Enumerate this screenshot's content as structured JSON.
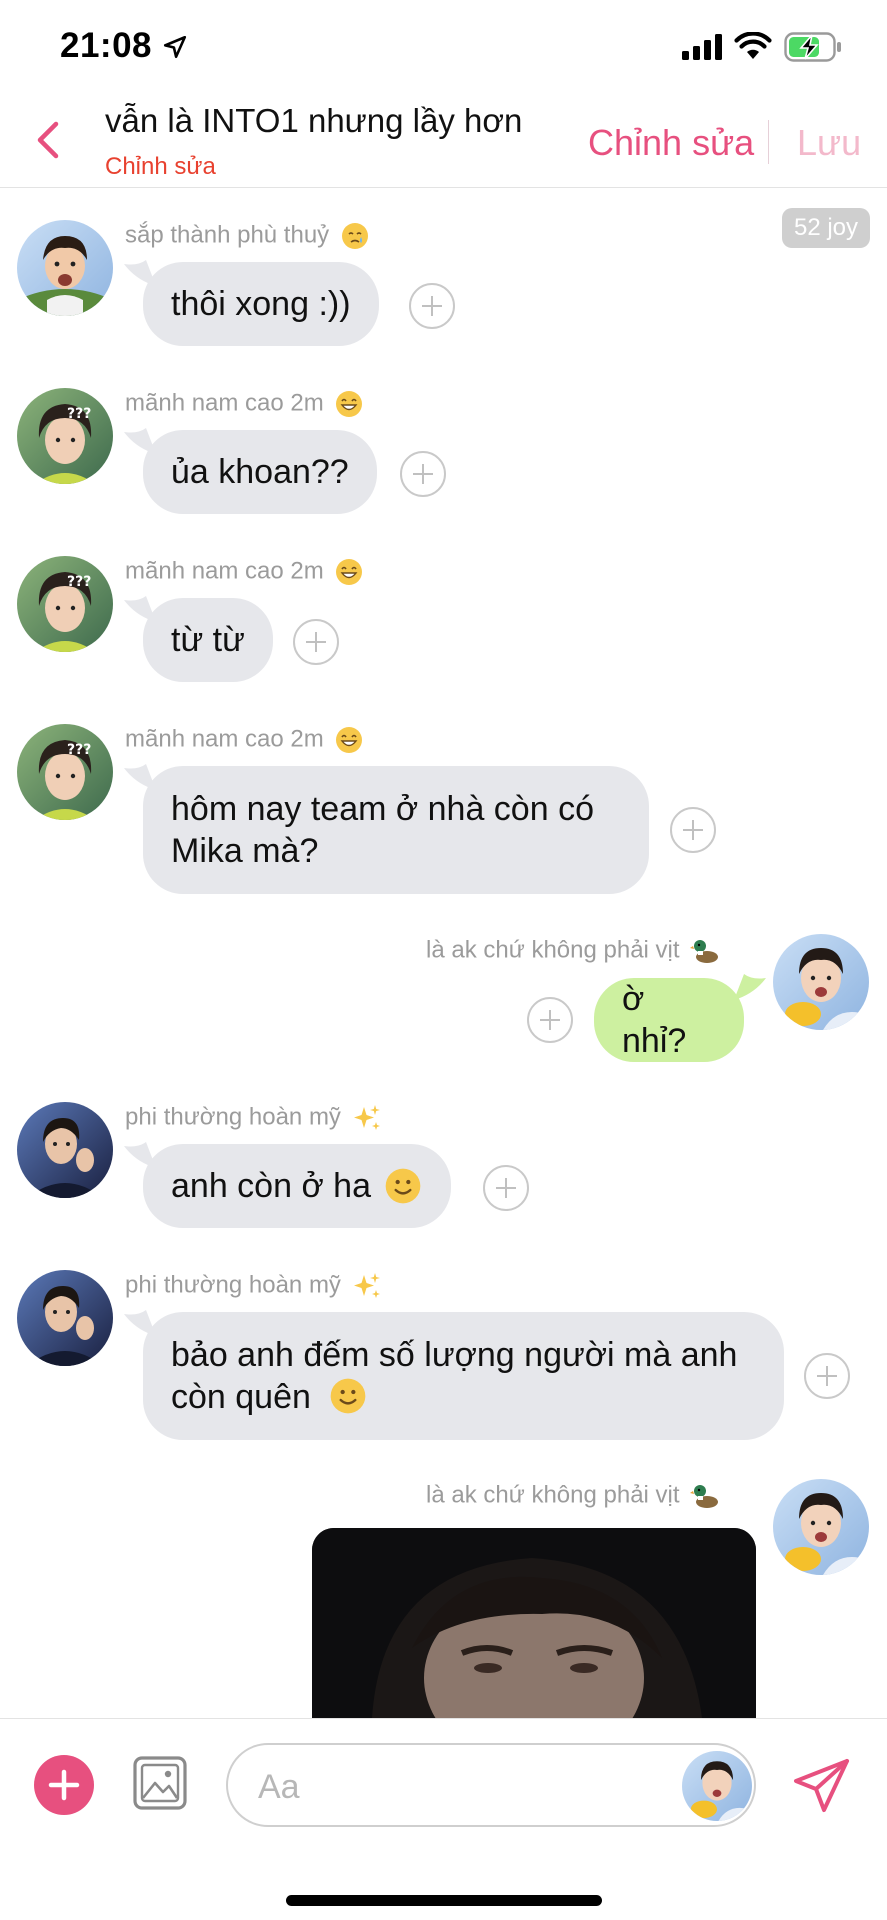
{
  "status_bar": {
    "time": "21:08"
  },
  "header": {
    "title": "vẫn là INTO1 nhưng lầy hơn",
    "subtitle": "Chỉnh sửa",
    "edit_label": "Chỉnh sửa",
    "save_label": "Lưu"
  },
  "joy_badge": "52 joy",
  "messages": [
    {
      "sender": "sắp thành phù thuỷ",
      "text": "thôi xong :))"
    },
    {
      "sender": "mãnh nam cao 2m",
      "text": "ủa khoan??"
    },
    {
      "sender": "mãnh nam cao 2m",
      "text": "từ từ"
    },
    {
      "sender": "mãnh nam cao 2m",
      "text_lines": [
        "hôm nay team ở nhà còn có",
        "Mika mà?"
      ]
    },
    {
      "sender": "là ak chứ không phải vịt",
      "text": "ờ nhỉ?"
    },
    {
      "sender": "phi thường hoàn mỹ",
      "text": "anh còn ở ha"
    },
    {
      "sender": "phi thường hoàn mỹ",
      "text_lines": [
        "bảo anh đếm số lượng người mà anh",
        "còn quên"
      ]
    },
    {
      "sender": "là ak chứ không phải vịt"
    }
  ],
  "input": {
    "placeholder": "Aa"
  },
  "colors": {
    "accent": "#e7507f",
    "subtitle_red": "#e8412f",
    "bubble_other": "#e6e7eb",
    "bubble_mine": "#cdf0a0"
  }
}
